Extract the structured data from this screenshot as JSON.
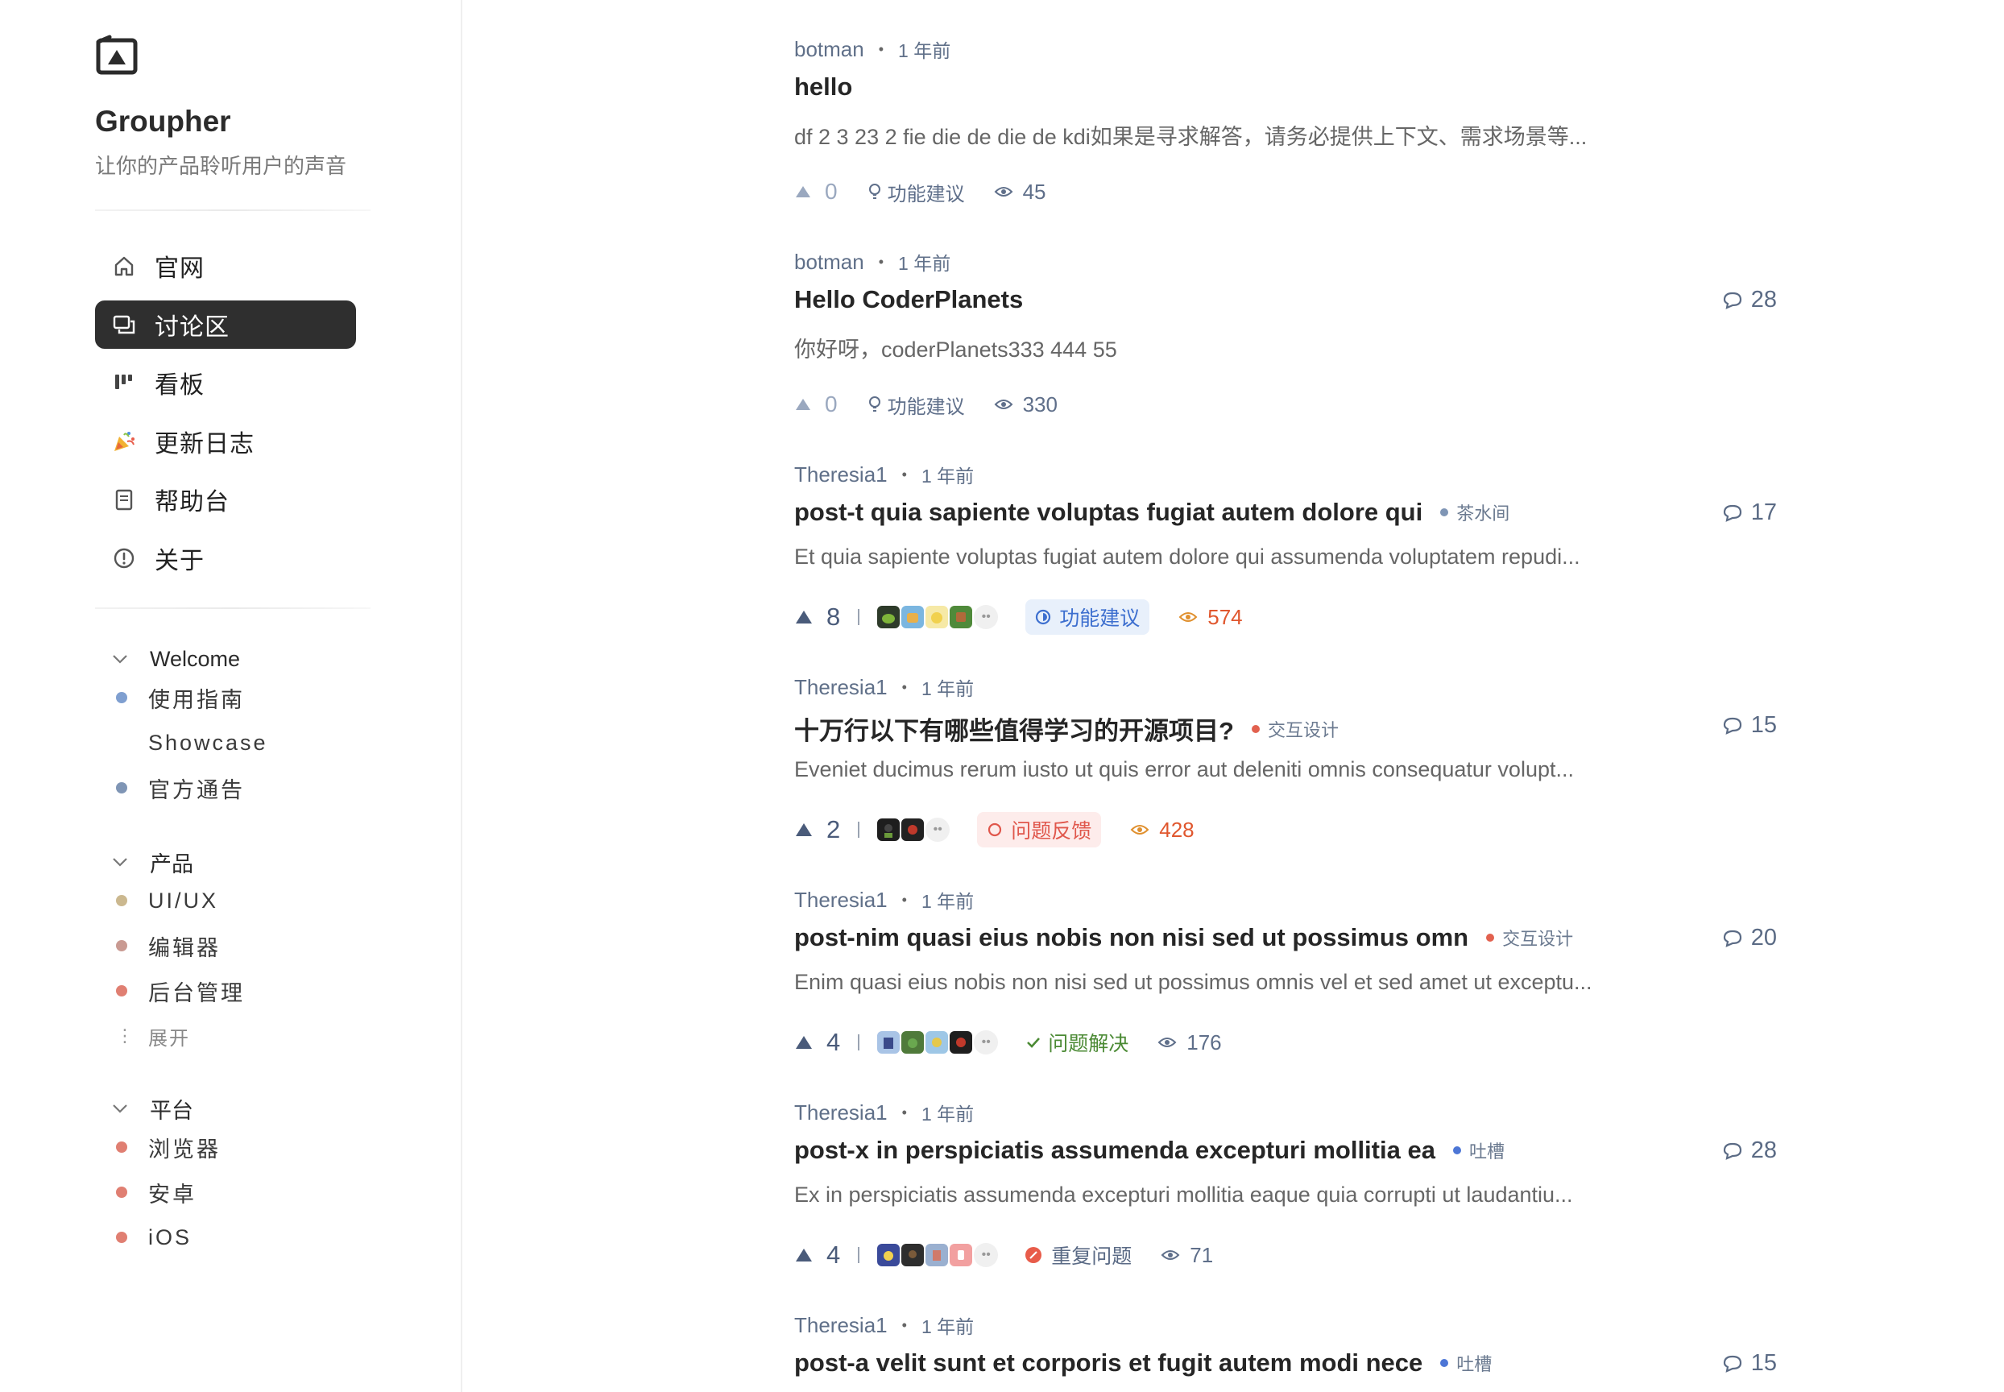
{
  "brand": {
    "name": "Groupher",
    "slogan": "让你的产品聆听用户的声音"
  },
  "nav": [
    {
      "label": "官网",
      "icon": "home-icon",
      "active": false
    },
    {
      "label": "讨论区",
      "icon": "discussion-icon",
      "active": true
    },
    {
      "label": "看板",
      "icon": "kanban-icon",
      "active": false
    },
    {
      "label": "更新日志",
      "icon": "party-popper-icon",
      "active": false
    },
    {
      "label": "帮助台",
      "icon": "document-icon",
      "active": false
    },
    {
      "label": "关于",
      "icon": "info-icon",
      "active": false
    }
  ],
  "groups": [
    {
      "title": "Welcome",
      "items": [
        {
          "label": "使用指南",
          "color": "#7f9fd0"
        },
        {
          "label": "Showcase",
          "color": ""
        },
        {
          "label": "官方通告",
          "color": "#7f95b5"
        }
      ]
    },
    {
      "title": "产品",
      "items": [
        {
          "label": "UI/UX",
          "color": "#cbb88f"
        },
        {
          "label": "编辑器",
          "color": "#c99a92"
        },
        {
          "label": "后台管理",
          "color": "#e07f72"
        }
      ],
      "expand_label": "展开"
    },
    {
      "title": "平台",
      "items": [
        {
          "label": "浏览器",
          "color": "#e07f72"
        },
        {
          "label": "安卓",
          "color": "#e07f72"
        },
        {
          "label": "iOS",
          "color": "#e07f72"
        }
      ]
    }
  ],
  "posts": [
    {
      "author": "botman",
      "time": "1 年前",
      "title": "hello",
      "tag": "",
      "excerpt": "df 2 3 23 2 fie die de die de kdi如果是寻求解答，请务必提供上下文、需求场景等...",
      "comments": "",
      "upvotes": "0",
      "label": "功能建议",
      "views": "45"
    },
    {
      "author": "botman",
      "time": "1 年前",
      "title": "Hello CoderPlanets",
      "tag": "",
      "excerpt": "你好呀，coderPlanets333 444 55",
      "comments": "28",
      "upvotes": "0",
      "label": "功能建议",
      "views": "330"
    },
    {
      "author": "Theresia1",
      "time": "1 年前",
      "title": "post-t quia sapiente voluptas fugiat autem dolore qui",
      "tag": "茶水间",
      "tag_color": "#7f95b5",
      "excerpt": "Et quia sapiente voluptas fugiat autem dolore qui assumenda voluptatem repudi...",
      "comments": "17",
      "upvotes": "8",
      "label": "功能建议",
      "views": "574"
    },
    {
      "author": "Theresia1",
      "time": "1 年前",
      "title": "十万行以下有哪些值得学习的开源项目?",
      "tag": "交互设计",
      "tag_color": "#e2614f",
      "excerpt": "Eveniet ducimus rerum iusto ut quis error aut deleniti omnis consequatur volupt...",
      "comments": "15",
      "upvotes": "2",
      "label": "问题反馈",
      "views": "428"
    },
    {
      "author": "Theresia1",
      "time": "1 年前",
      "title": "post-nim quasi eius nobis non nisi sed ut possimus omn",
      "tag": "交互设计",
      "tag_color": "#e2614f",
      "excerpt": "Enim quasi eius nobis non nisi sed ut possimus omnis vel et sed amet ut exceptu...",
      "comments": "20",
      "upvotes": "4",
      "label": "问题解决",
      "views": "176"
    },
    {
      "author": "Theresia1",
      "time": "1 年前",
      "title": "post-x in perspiciatis assumenda excepturi mollitia ea",
      "tag": "吐槽",
      "tag_color": "#4d76d6",
      "excerpt": "Ex in perspiciatis assumenda excepturi mollitia eaque quia corrupti ut laudantiu...",
      "comments": "28",
      "upvotes": "4",
      "label": "重复问题",
      "views": "71"
    },
    {
      "author": "Theresia1",
      "time": "1 年前",
      "title": "post-a velit sunt et corporis et fugit autem modi nece",
      "tag": "吐槽",
      "tag_color": "#4d76d6",
      "excerpt": "",
      "comments": "15",
      "upvotes": "",
      "label": "",
      "views": ""
    }
  ],
  "colors": {
    "active_nav_bg": "#2f2f2f",
    "hot_views": "#e0572e",
    "meta": "#607089"
  }
}
